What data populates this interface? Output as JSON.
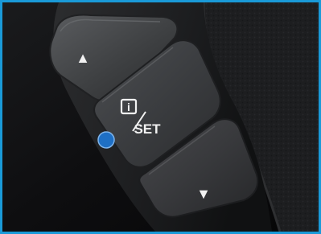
{
  "buttons": {
    "up": {
      "glyph": "▲"
    },
    "info_set": {
      "info_glyph": "i",
      "label": "SET"
    },
    "down": {
      "glyph": "▼"
    }
  },
  "marker": {
    "color": "#1e6fc4"
  },
  "colors": {
    "frame_border": "#1a9ad8",
    "background": "#0c0c0d",
    "button_face": "#3a3b3d",
    "button_symbol": "#f2f2f2"
  }
}
